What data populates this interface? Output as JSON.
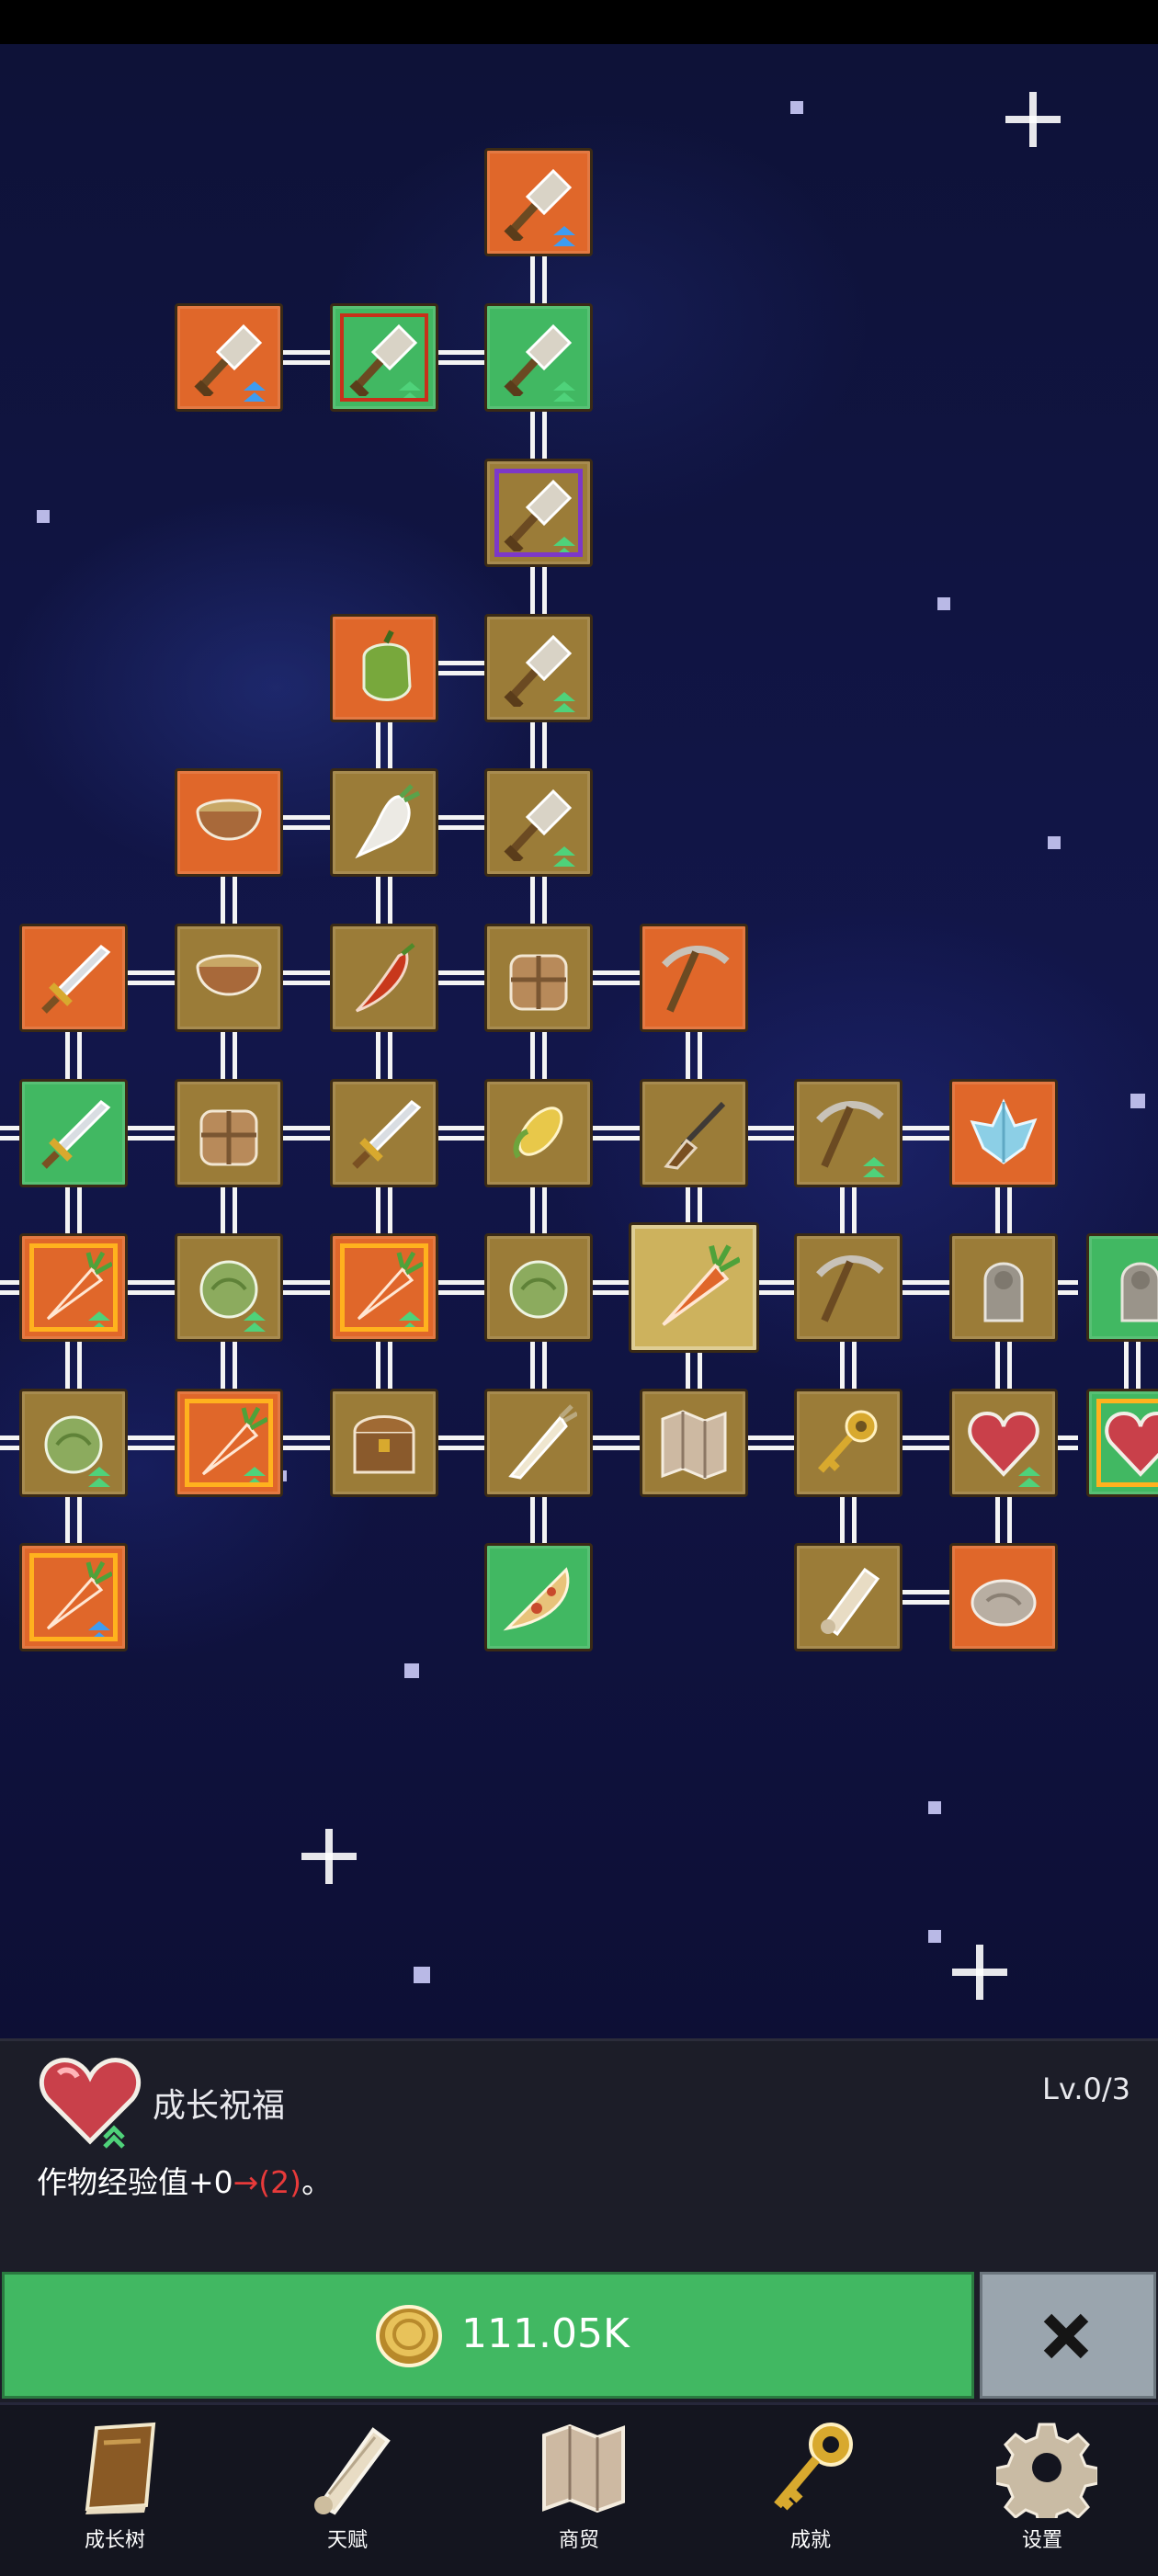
{
  "detail_panel": {
    "title": "成长祝福",
    "level": "Lv.0/3",
    "desc_prefix": "作物经验值+0",
    "desc_arrow_value": "→(2)",
    "desc_suffix": "。",
    "icon": "heart-growth-icon"
  },
  "buy_button": {
    "cost": "111.05K",
    "icon": "gold-coin-icon"
  },
  "close_button": {
    "icon": "close-x-icon"
  },
  "nav": [
    {
      "label": "成长树",
      "icon": "book-icon"
    },
    {
      "label": "天赋",
      "icon": "scroll-icon"
    },
    {
      "label": "商贸",
      "icon": "map-icon"
    },
    {
      "label": "成就",
      "icon": "key-icon"
    },
    {
      "label": "设置",
      "icon": "gear-icon"
    }
  ],
  "colors": {
    "tier_orange": "#e0672a",
    "tier_green": "#41b862",
    "tier_purple": "#8f5ccc",
    "tier_brown": "#9b7c38",
    "tier_selected": "#cdb25d",
    "button_green": "#41b862",
    "button_gray": "#9aa5ae"
  },
  "tree_nodes": [
    {
      "icon": "shovel-icon",
      "tier": "orange",
      "upgrade": "blue"
    },
    {
      "icon": "shovel-icon",
      "tier": "orange",
      "upgrade": "blue"
    },
    {
      "icon": "shovel-icon",
      "tier": "green",
      "upgrade": "green",
      "frame": "red"
    },
    {
      "icon": "shovel-icon",
      "tier": "green",
      "upgrade": "green"
    },
    {
      "icon": "shovel-icon",
      "tier": "brown",
      "upgrade": "green",
      "frame": "purple"
    },
    {
      "icon": "bell-pepper-icon",
      "tier": "orange"
    },
    {
      "icon": "shovel-icon",
      "tier": "brown",
      "upgrade": "green"
    },
    {
      "icon": "bowl-icon",
      "tier": "orange"
    },
    {
      "icon": "radish-icon",
      "tier": "brown"
    },
    {
      "icon": "shovel-icon",
      "tier": "brown",
      "upgrade": "green"
    },
    {
      "icon": "sword-icon",
      "tier": "orange"
    },
    {
      "icon": "bowl-icon",
      "tier": "brown"
    },
    {
      "icon": "chili-icon",
      "tier": "brown"
    },
    {
      "icon": "backpack-icon",
      "tier": "brown"
    },
    {
      "icon": "pickaxe-icon",
      "tier": "orange"
    },
    {
      "icon": "sword-icon",
      "tier": "green"
    },
    {
      "icon": "backpack-icon",
      "tier": "brown"
    },
    {
      "icon": "sword-icon",
      "tier": "brown"
    },
    {
      "icon": "corn-icon",
      "tier": "brown"
    },
    {
      "icon": "rifle-icon",
      "tier": "brown"
    },
    {
      "icon": "pickaxe-icon",
      "tier": "brown",
      "upgrade": "green"
    },
    {
      "icon": "crystal-icon",
      "tier": "orange"
    },
    {
      "icon": "carrot-icon",
      "tier": "orange",
      "upgrade": "green",
      "frame": "orange"
    },
    {
      "icon": "cabbage-icon",
      "tier": "brown",
      "upgrade": "green"
    },
    {
      "icon": "carrot-icon",
      "tier": "orange",
      "upgrade": "green",
      "frame": "orange"
    },
    {
      "icon": "cabbage-icon",
      "tier": "brown"
    },
    {
      "icon": "carrot-icon",
      "tier": "selected"
    },
    {
      "icon": "pickaxe-icon",
      "tier": "brown"
    },
    {
      "icon": "statue-icon",
      "tier": "brown"
    },
    {
      "icon": "statue-icon",
      "tier": "green"
    },
    {
      "icon": "cabbage-icon",
      "tier": "brown",
      "upgrade": "green"
    },
    {
      "icon": "carrot-icon",
      "tier": "orange",
      "upgrade": "green",
      "frame": "orange"
    },
    {
      "icon": "treasure-chest-icon",
      "tier": "brown"
    },
    {
      "icon": "parsnip-icon",
      "tier": "brown"
    },
    {
      "icon": "map-icon",
      "tier": "brown"
    },
    {
      "icon": "key-icon",
      "tier": "brown"
    },
    {
      "icon": "heart-icon",
      "tier": "brown",
      "upgrade": "green"
    },
    {
      "icon": "heart-icon",
      "tier": "green",
      "frame": "orange"
    },
    {
      "icon": "carrot-icon",
      "tier": "orange",
      "upgrade": "blue",
      "frame": "orange"
    },
    {
      "icon": "pizza-icon",
      "tier": "green"
    },
    {
      "icon": "scroll-icon",
      "tier": "brown"
    },
    {
      "icon": "stone-icon",
      "tier": "orange"
    }
  ]
}
